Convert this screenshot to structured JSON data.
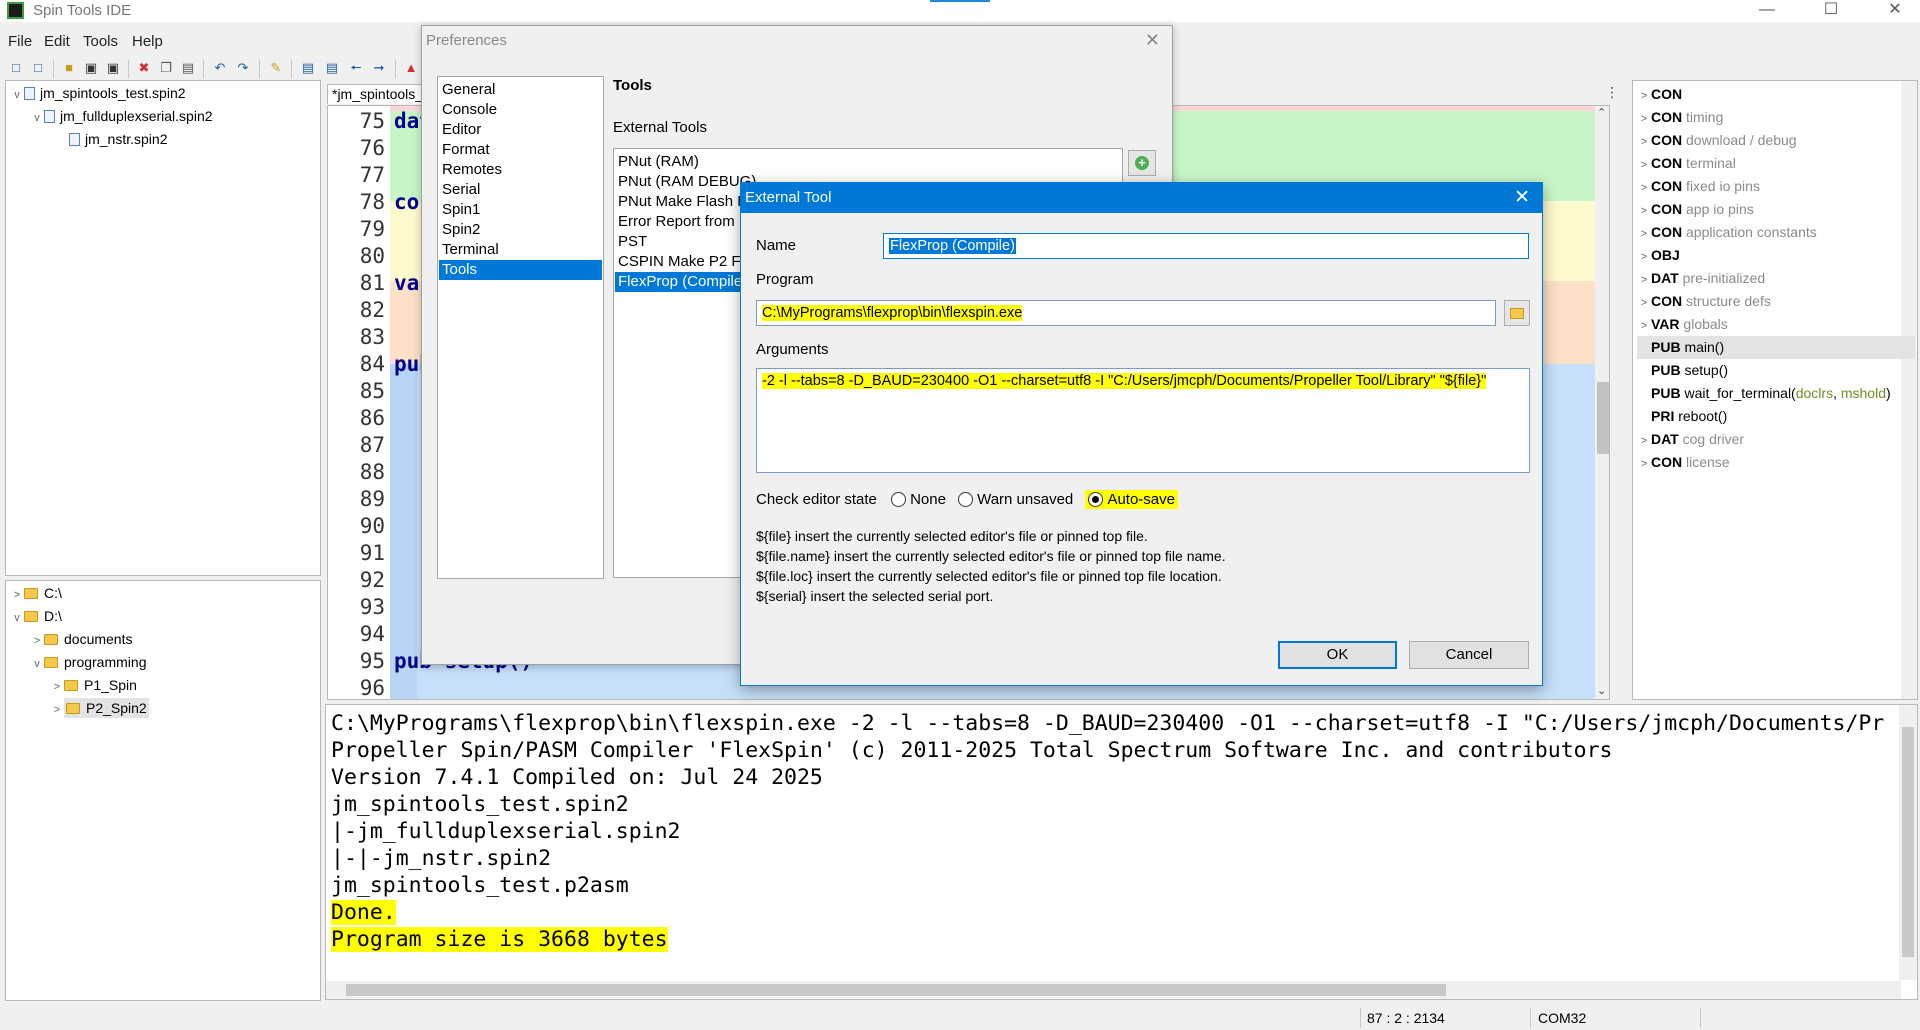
{
  "app": {
    "title": "Spin Tools IDE"
  },
  "menu": [
    "File",
    "Edit",
    "Tools",
    "Help"
  ],
  "project_tree": [
    {
      "label": "jm_spintools_test.spin2",
      "level": 0,
      "expanded": true
    },
    {
      "label": "jm_fullduplexserial.spin2",
      "level": 1,
      "expanded": true
    },
    {
      "label": "jm_nstr.spin2",
      "level": 2,
      "expanded": false
    }
  ],
  "file_tree": [
    {
      "label": "C:\\",
      "level": 0,
      "chevron": ">"
    },
    {
      "label": "D:\\",
      "level": 0,
      "chevron": "v"
    },
    {
      "label": "documents",
      "level": 1,
      "chevron": ">"
    },
    {
      "label": "programming",
      "level": 1,
      "chevron": "v"
    },
    {
      "label": "P1_Spin",
      "level": 2,
      "chevron": ">"
    },
    {
      "label": "P2_Spin2",
      "level": 2,
      "chevron": ">"
    }
  ],
  "editor": {
    "tab_label": "*jm_spintools_",
    "line_numbers": [
      "75",
      "76",
      "77",
      "78",
      "79",
      "80",
      "81",
      "82",
      "83",
      "84",
      "85",
      "86",
      "87",
      "88",
      "89",
      "90",
      "91",
      "92",
      "93",
      "94",
      "95",
      "96"
    ],
    "code": {
      "75": "dat",
      "78": "con",
      "81": "var",
      "84": "pub",
      "95": "pub setup()"
    }
  },
  "outline": [
    {
      "kw": "CON",
      "desc": "",
      "chevron": true
    },
    {
      "kw": "CON",
      "desc": "timing",
      "chevron": true
    },
    {
      "kw": "CON",
      "desc": "download / debug",
      "chevron": true
    },
    {
      "kw": "CON",
      "desc": "terminal",
      "chevron": true
    },
    {
      "kw": "CON",
      "desc": "fixed io pins",
      "chevron": true
    },
    {
      "kw": "CON",
      "desc": "app io pins",
      "chevron": true
    },
    {
      "kw": "CON",
      "desc": "application constants",
      "chevron": true
    },
    {
      "kw": "OBJ",
      "desc": "",
      "chevron": true
    },
    {
      "kw": "DAT",
      "desc": "pre-initialized",
      "chevron": true
    },
    {
      "kw": "CON",
      "desc": "structure defs",
      "chevron": true
    },
    {
      "kw": "VAR",
      "desc": "globals",
      "chevron": true
    },
    {
      "kw": "PUB",
      "desc": "main()",
      "chevron": false,
      "selected": true
    },
    {
      "kw": "PUB",
      "desc": "setup()",
      "chevron": false
    },
    {
      "kw": "PUB",
      "desc": "wait_for_terminal(",
      "chevron": false
    },
    {
      "kw": "PRI",
      "desc": "reboot()",
      "chevron": false
    },
    {
      "kw": "DAT",
      "desc": "cog driver",
      "chevron": true
    },
    {
      "kw": "CON",
      "desc": "license",
      "chevron": true
    }
  ],
  "outline_params": {
    "p1": "doclrs",
    "sep": ", ",
    "p2": "mshold",
    "close": ")"
  },
  "console": [
    {
      "text": "C:\\MyPrograms\\flexprop\\bin\\flexspin.exe -2 -l --tabs=8 -D_BAUD=230400 -O1 --charset=utf8 -I \"C:/Users/jmcph/Documents/Pr",
      "hl": false
    },
    {
      "text": "Propeller Spin/PASM Compiler 'FlexSpin' (c) 2011-2025 Total Spectrum Software Inc. and contributors",
      "hl": false
    },
    {
      "text": "Version 7.4.1 Compiled on: Jul 24 2025",
      "hl": false
    },
    {
      "text": "jm_spintools_test.spin2",
      "hl": false
    },
    {
      "text": "|-jm_fullduplexserial.spin2",
      "hl": false
    },
    {
      "text": "|-|-jm_nstr.spin2",
      "hl": false
    },
    {
      "text": "jm_spintools_test.p2asm",
      "hl": false
    },
    {
      "text": "Done.",
      "hl": true
    },
    {
      "text": "Program size is 3668 bytes",
      "hl": true
    }
  ],
  "status": {
    "position": "87 : 2 : 2134",
    "port": "COM32"
  },
  "preferences": {
    "title": "Preferences",
    "categories": [
      "General",
      "Console",
      "Editor",
      "Format",
      "Remotes",
      "Serial",
      "Spin1",
      "Spin2",
      "Terminal",
      "Tools"
    ],
    "selected_category": "Tools",
    "section_title": "Tools",
    "external_tools_label": "External Tools",
    "tools": [
      "PNut (RAM)",
      "PNut (RAM DEBUG)",
      "PNut Make Flash Fi",
      "Error Report from F",
      "PST",
      "CSPIN Make P2 Flas",
      "FlexProp (Compile)"
    ],
    "selected_tool": "FlexProp (Compile)"
  },
  "external_tool": {
    "title": "External Tool",
    "name_label": "Name",
    "name_value": "FlexProp (Compile)",
    "program_label": "Program",
    "program_value": "C:\\MyPrograms\\flexprop\\bin\\flexspin.exe",
    "arguments_label": "Arguments",
    "arguments_value": "-2 -l --tabs=8 -D_BAUD=230400 -O1 --charset=utf8 -I \"C:/Users/jmcph/Documents/Propeller Tool/Library\" \"${file}\"",
    "check_state_label": "Check editor state",
    "options": [
      "None",
      "Warn unsaved",
      "Auto-save"
    ],
    "selected_option": "Auto-save",
    "help": [
      "${file} insert the currently selected editor's file or pinned top file.",
      "${file.name} insert the currently selected editor's file or pinned top file name.",
      "${file.loc} insert the currently selected editor's file or pinned top file location.",
      "${serial} insert the selected serial port."
    ],
    "ok_label": "OK",
    "cancel_label": "Cancel"
  }
}
